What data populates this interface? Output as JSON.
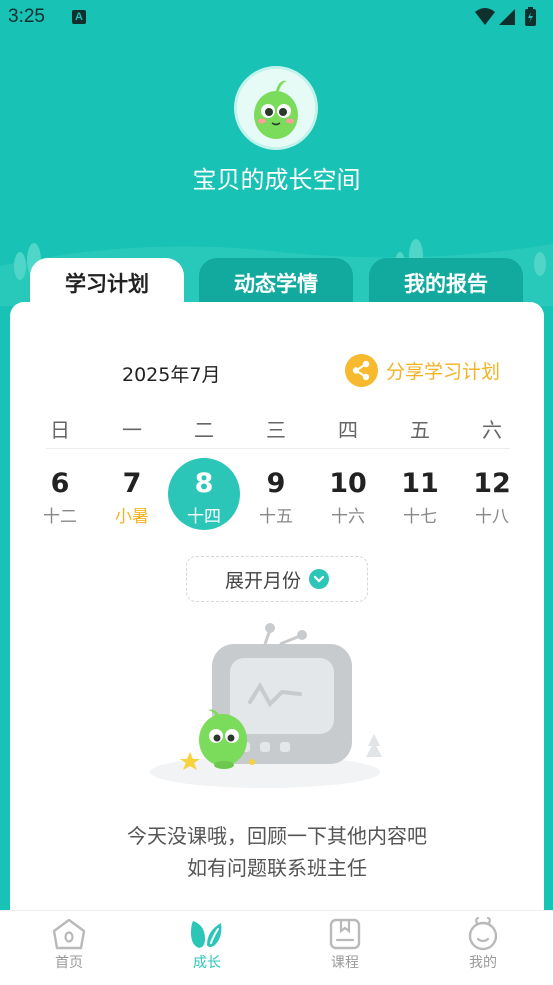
{
  "status": {
    "time": "3:25",
    "notification_letter": "A"
  },
  "hero": {
    "title": "宝贝的成长空间"
  },
  "tabs": [
    {
      "label": "学习计划",
      "active": true
    },
    {
      "label": "动态学情",
      "active": false
    },
    {
      "label": "我的报告",
      "active": false
    }
  ],
  "calendar": {
    "month_label": "2025年7月",
    "share_label": "分享学习计划",
    "weekdays": [
      "日",
      "一",
      "二",
      "三",
      "四",
      "五",
      "六"
    ],
    "days": [
      {
        "num": "6",
        "lunar": "十二"
      },
      {
        "num": "7",
        "lunar": "小暑",
        "solar_term": true
      },
      {
        "num": "8",
        "lunar": "十四",
        "selected": true
      },
      {
        "num": "9",
        "lunar": "十五"
      },
      {
        "num": "10",
        "lunar": "十六"
      },
      {
        "num": "11",
        "lunar": "十七"
      },
      {
        "num": "12",
        "lunar": "十八"
      }
    ],
    "expand_label": "展开月份"
  },
  "empty_state": {
    "line1": "今天没课哦，回顾一下其他内容吧",
    "line2": "如有问题联系班主任"
  },
  "bottom_nav": [
    {
      "label": "首页",
      "icon": "home-icon",
      "active": false
    },
    {
      "label": "成长",
      "icon": "growth-leaf-icon",
      "active": true
    },
    {
      "label": "课程",
      "icon": "course-book-icon",
      "active": false
    },
    {
      "label": "我的",
      "icon": "profile-icon",
      "active": false
    }
  ],
  "colors": {
    "brand": "#18C2B4",
    "accent": "#2CC6B8",
    "highlight": "#F2B325"
  }
}
